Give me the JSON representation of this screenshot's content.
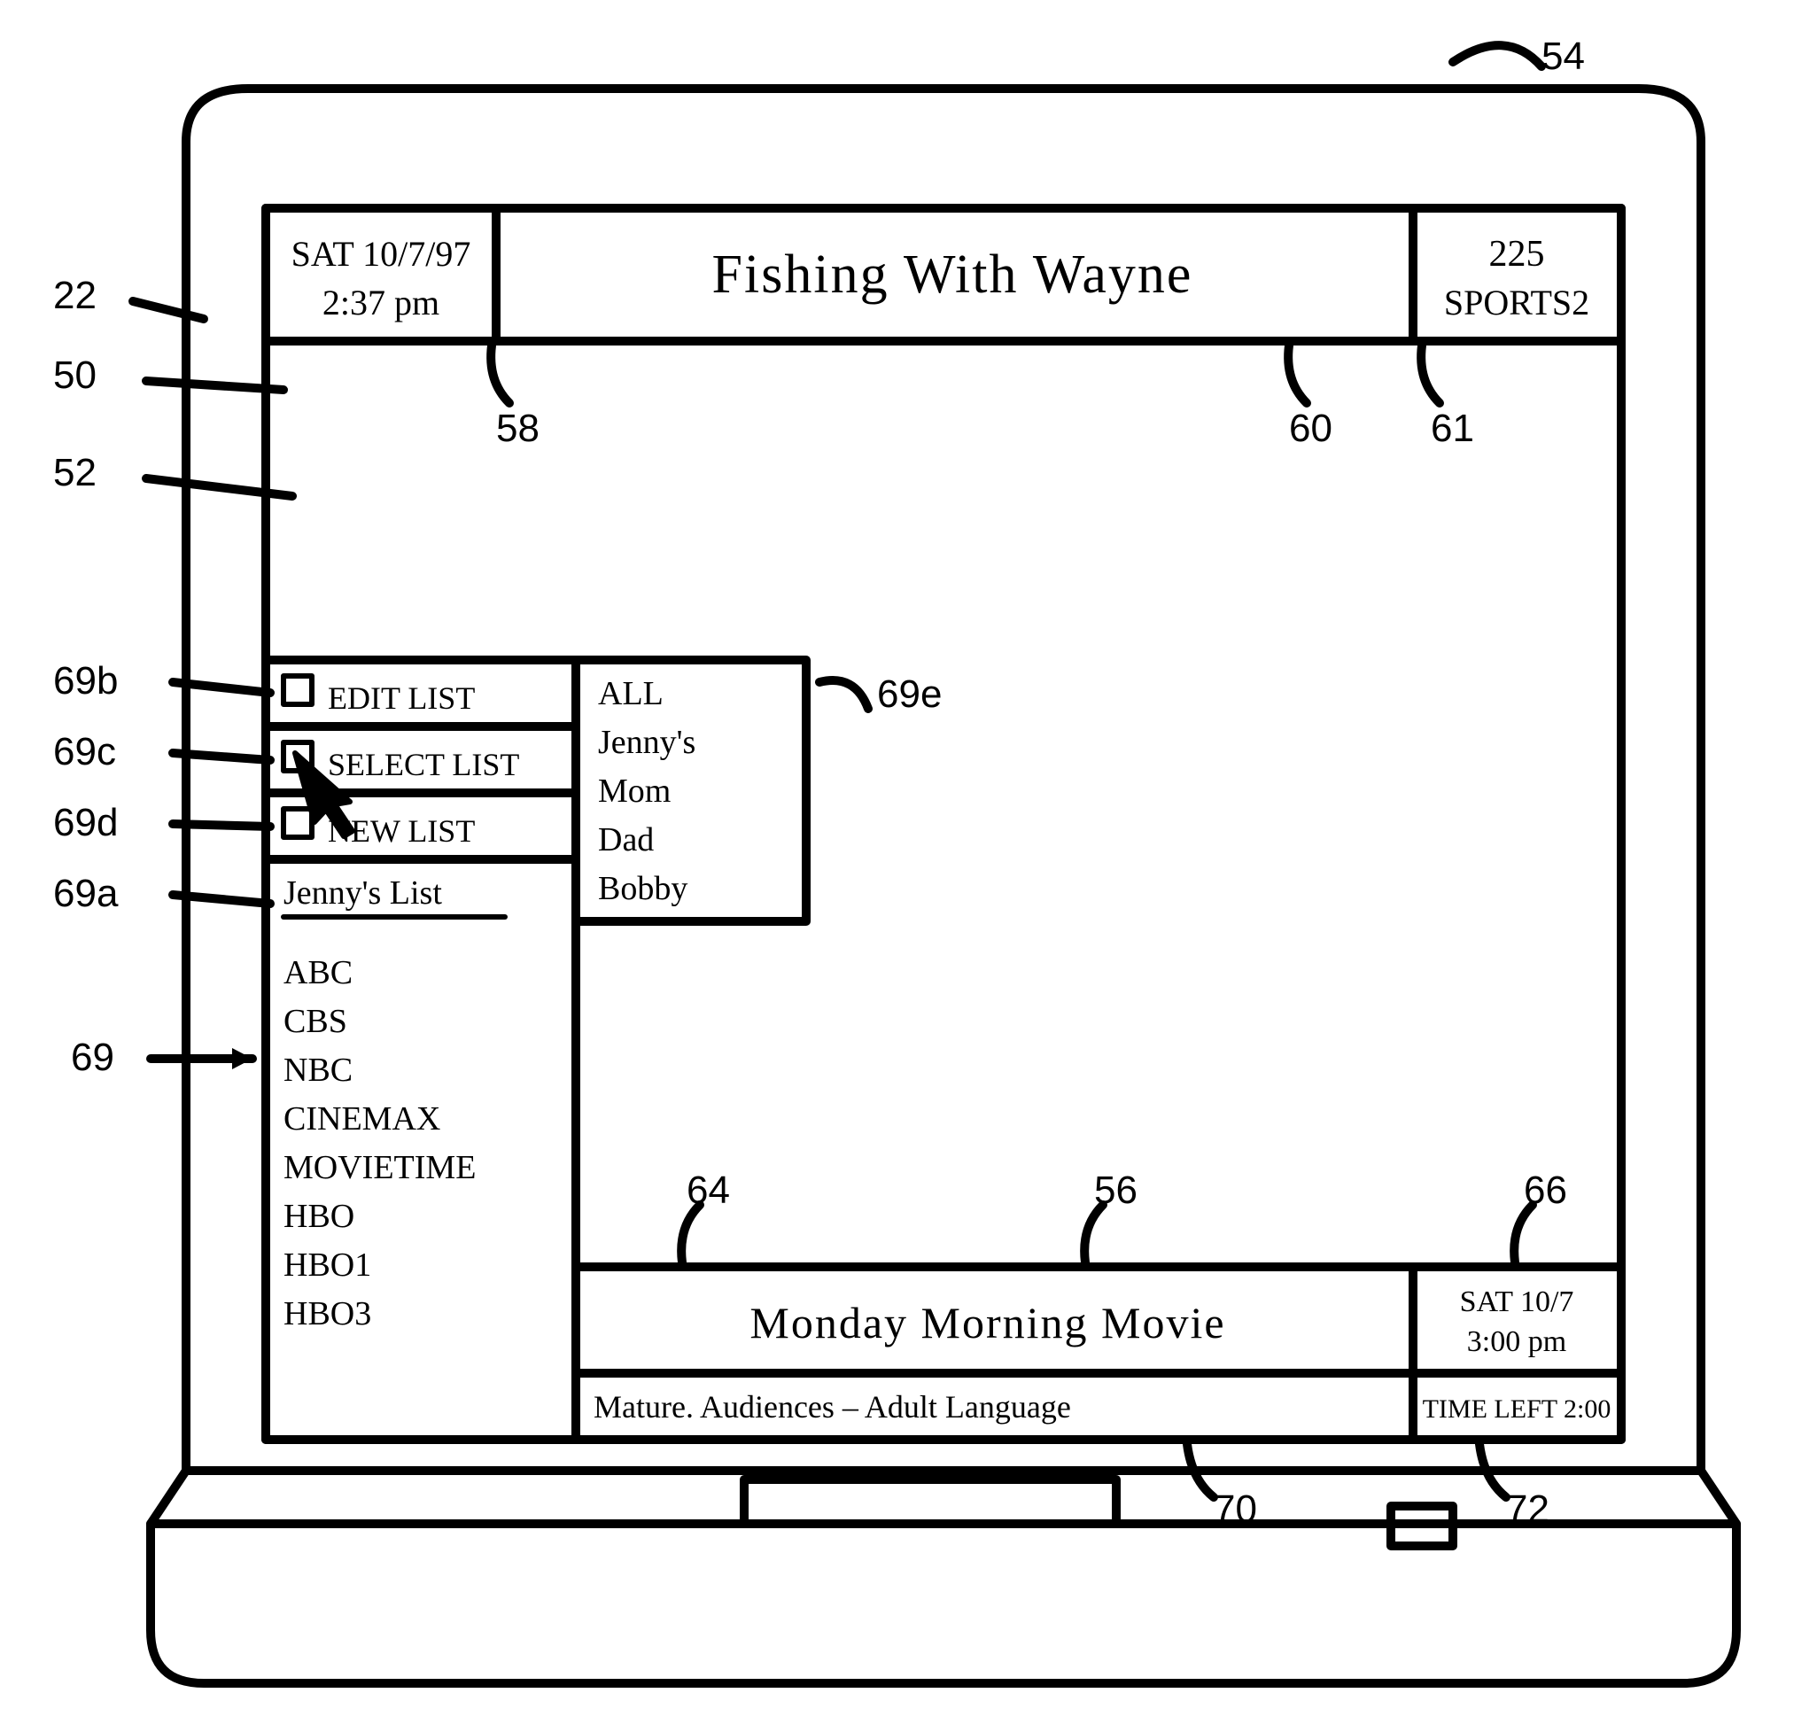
{
  "header": {
    "datetime_weekday": "SAT",
    "datetime_date": "10/7/97",
    "datetime_time": "2:37 pm",
    "title": "Fishing With Wayne",
    "channel_number": "225",
    "channel_name": "SPORTS2"
  },
  "menu": {
    "edit_label": "EDIT LIST",
    "select_label": "SELECT LIST",
    "new_label": "NEW LIST",
    "list_title": "Jenny's List",
    "channels": [
      "ABC",
      "CBS",
      "NBC",
      "CINEMAX",
      "MOVIETIME",
      "HBO",
      "HBO1",
      "HBO3"
    ],
    "profiles": [
      "ALL",
      "Jenny's",
      "Mom",
      "Dad",
      "Bobby"
    ]
  },
  "footer": {
    "program_title": "Monday Morning Movie",
    "next_date": "SAT 10/7",
    "next_time": "3:00 pm",
    "rating": "Mature. Audiences  –  Adult Language",
    "time_left": "TIME LEFT  2:00"
  },
  "refs": {
    "r22": "22",
    "r50": "50",
    "r52": "52",
    "r54": "54",
    "r56": "56",
    "r58": "58",
    "r60": "60",
    "r61": "61",
    "r64": "64",
    "r66": "66",
    "r69": "69",
    "r69a": "69a",
    "r69b": "69b",
    "r69c": "69c",
    "r69d": "69d",
    "r69e": "69e",
    "r70": "70",
    "r72": "72"
  }
}
